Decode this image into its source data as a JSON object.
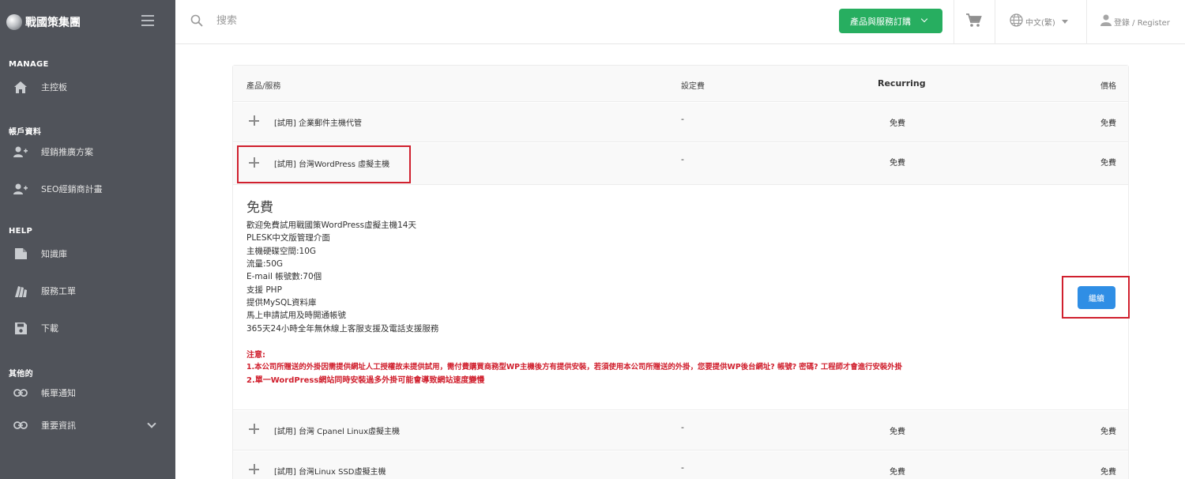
{
  "brand": {
    "name": "戰國策集團"
  },
  "sidebar": {
    "sections": [
      {
        "title": "MANAGE",
        "items": [
          {
            "label": "主控板",
            "icon": "home-icon"
          }
        ]
      },
      {
        "title": "帳戶資料",
        "items": [
          {
            "label": "經銷推廣方案",
            "icon": "add-user-icon"
          },
          {
            "label": "SEO經銷商計畫",
            "icon": "add-user-icon"
          }
        ]
      },
      {
        "title": "HELP",
        "items": [
          {
            "label": "知識庫",
            "icon": "folder-icon"
          },
          {
            "label": "服務工單",
            "icon": "ticket-icon"
          },
          {
            "label": "下載",
            "icon": "floppy-icon"
          }
        ]
      },
      {
        "title": "其他的",
        "items": [
          {
            "label": "帳單通知",
            "icon": "link-icon"
          },
          {
            "label": "重要資訊",
            "icon": "link-icon"
          }
        ]
      }
    ]
  },
  "topbar": {
    "search_placeholder": "搜索",
    "order_button": "產品與服務訂購",
    "language": "中文(繁)",
    "login": "登錄 / Register"
  },
  "table": {
    "headers": {
      "product": "產品/服務",
      "setup": "設定費",
      "recurring": "Recurring",
      "price": "價格"
    },
    "rows": [
      {
        "name": "[試用] 企業郵件主機代管",
        "setup": "-",
        "recurring": "免費",
        "price": "免費"
      },
      {
        "name": "[試用] 台灣WordPress 虛擬主機",
        "setup": "-",
        "recurring": "免費",
        "price": "免費"
      },
      {
        "name": "[試用] 台灣 Cpanel Linux虛擬主機",
        "setup": "-",
        "recurring": "免費",
        "price": "免費"
      },
      {
        "name": "[試用] 台灣Linux SSD虛擬主機",
        "setup": "-",
        "recurring": "免費",
        "price": "免費"
      }
    ]
  },
  "detail": {
    "price": "免費",
    "features": [
      "歡迎免費試用戰國策WordPress虛擬主機14天",
      "PLESK中文版管理介面",
      "主機硬碟空間:10G",
      "流量:50G",
      "E-mail 帳號數:70個",
      "支援 PHP",
      "提供MySQL資料庫",
      "馬上申請試用及時開通帳號",
      "365天24小時全年無休線上客服支援及電話支援服務"
    ],
    "notes": [
      "注意:",
      "1.本公司所贈送的外掛因需提供網址人工授權故未提供試用，需付費購買商務型WP主機後方有提供安裝，若須使用本公司所贈送的外掛，您要提供WP後台網址? 帳號? 密碼? 工程師才會進行安裝外掛",
      "2.單一WordPress網站同時安裝過多外掛可能會導致網站速度變慢"
    ],
    "continue_button": "繼續"
  },
  "colors": {
    "sidebar_bg": "#50535a",
    "accent_green": "#27ae60",
    "accent_blue": "#2f8ee5",
    "highlight_red": "#d0202e"
  }
}
